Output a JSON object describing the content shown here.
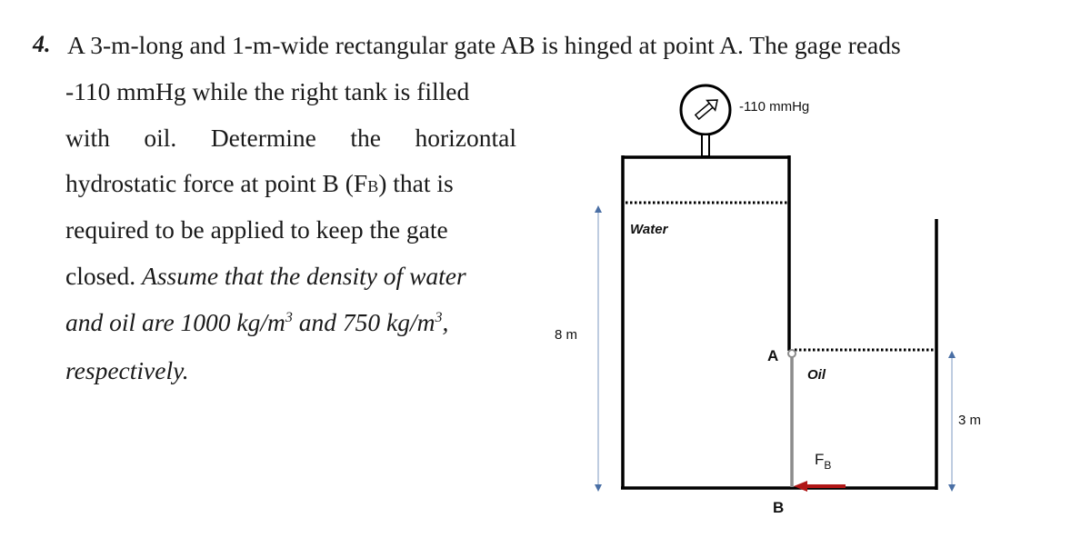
{
  "problem": {
    "number": "4.",
    "lines": [
      {
        "text": "A 3-m-long and 1-m-wide rectangular gate AB is hinged at point A. The gage reads"
      },
      {
        "text": "-110 mmHg while the right tank is filled"
      },
      {
        "text": "with oil. Determine the horizontal"
      },
      {
        "prefix": "hydrostatic force at point B (F",
        "sub": "B",
        "suffix": ") that is"
      },
      {
        "text": "required to be applied to keep the gate"
      },
      {
        "normal": "closed. ",
        "italic": "Assume that the density of water"
      },
      {
        "p1": "and oil are 1000 kg/m",
        "sup1": "3",
        "p2": " and 750 kg/m",
        "sup2": "3",
        "p3": ","
      },
      {
        "text": "respectively."
      }
    ]
  },
  "diagram": {
    "gage_reading": "-110 mmHg",
    "water_label": "Water",
    "oil_label": "Oil",
    "point_a_label": "A",
    "point_b_label": "B",
    "force_label": "F",
    "force_sub": "B",
    "water_depth_label": "8 m",
    "oil_depth_label": "3 m",
    "colors": {
      "wall": "#000000",
      "gate": "#8c8c8c",
      "force_arrow": "#b01616",
      "dimension": "#8fa6c8",
      "dimension_head": "#4a6fa5"
    }
  }
}
